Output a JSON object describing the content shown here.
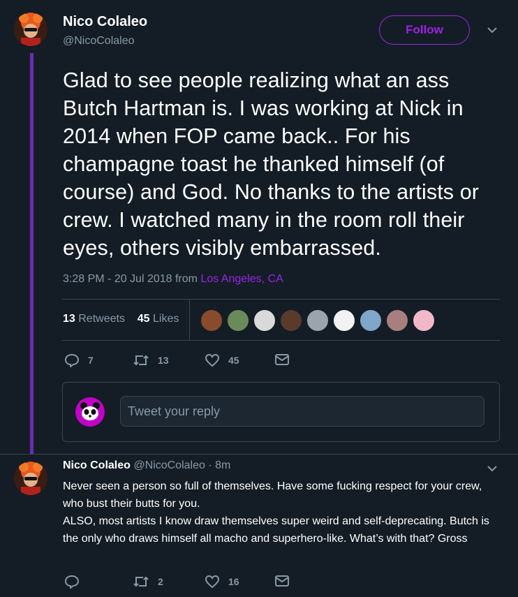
{
  "tweet": {
    "author_name": "Nico Colaleo",
    "author_handle": "@NicoColaleo",
    "follow_label": "Follow",
    "text": "Glad to see people realizing what an ass Butch Hartman is. I was working at Nick in 2014 when FOP came back.. For his champagne toast he thanked himself (of course) and God. No thanks to the artists or crew. I watched many in the room roll their eyes, others visibly embarrassed.",
    "timestamp": "3:28 PM - 20 Jul 2018 from",
    "location": "Los Angeles, CA",
    "retweets_count": "13",
    "retweets_label": "Retweets",
    "likes_count": "45",
    "likes_label": "Likes",
    "actions": {
      "replies": "7",
      "retweets": "13",
      "likes": "45"
    }
  },
  "reply_box": {
    "placeholder": "Tweet your reply"
  },
  "reply": {
    "author_name": "Nico Colaleo",
    "author_handle": "@NicoColaleo",
    "time": "· 8m",
    "text": "Never seen a person so full of themselves. Have some fucking respect for your crew, who bust their butts for you.\nALSO, most artists I know draw themselves super weird and self-deprecating. Butch is the only who draws himself all macho and superhero-like. What’s with that? Gross",
    "actions": {
      "replies": "",
      "retweets": "2",
      "likes": "16"
    }
  },
  "colors": {
    "background": "#141d26",
    "accent": "#9a24e5",
    "muted": "#8899a6",
    "border": "#38444d"
  }
}
